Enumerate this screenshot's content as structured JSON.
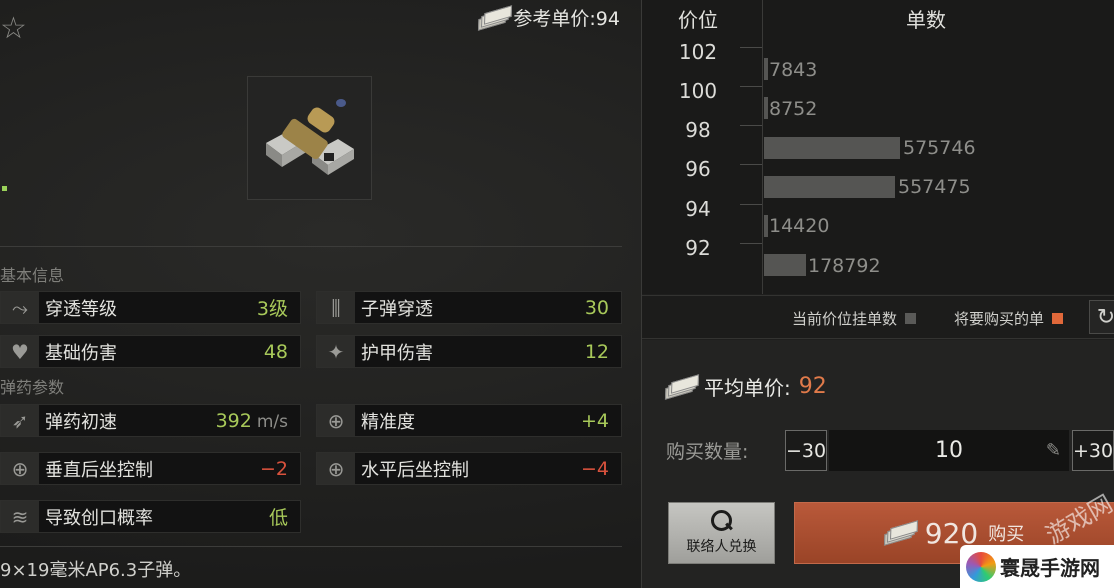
{
  "header": {
    "ref_price_label": "参考单价:94"
  },
  "sections": {
    "basic": "基本信息",
    "ammo": "弹药参数"
  },
  "stats": {
    "pen_level": {
      "name": "穿透等级",
      "value": "3级"
    },
    "bullet_pen": {
      "name": "子弹穿透",
      "value": "30"
    },
    "base_dmg": {
      "name": "基础伤害",
      "value": "48"
    },
    "armor_dmg": {
      "name": "护甲伤害",
      "value": "12"
    },
    "velocity": {
      "name": "弹药初速",
      "value": "392",
      "unit": "m/s"
    },
    "accuracy": {
      "name": "精准度",
      "value": "+4"
    },
    "v_recoil": {
      "name": "垂直后坐控制",
      "value": "−2"
    },
    "h_recoil": {
      "name": "水平后坐控制",
      "value": "−4"
    },
    "bleed": {
      "name": "导致创口概率",
      "value": "低"
    }
  },
  "description": "9×19毫米AP6.3子弹。",
  "market": {
    "col_price": "价位",
    "col_count": "单数",
    "rows": [
      {
        "price": "102",
        "count": ""
      },
      {
        "price": "100",
        "count": "7843"
      },
      {
        "price": "98",
        "count": "8752"
      },
      {
        "price": "96",
        "count": "575746"
      },
      {
        "price": "94",
        "count": "557475"
      },
      {
        "price": "92",
        "count": "14420"
      },
      {
        "price": "",
        "count": "178792"
      }
    ],
    "legend_current": "当前价位挂单数",
    "legend_buy": "将要购买的单",
    "current_color": "#5a5a58",
    "buy_color": "#e0683a"
  },
  "buy": {
    "avg_label": "平均单价:",
    "avg_value": "92",
    "qty_label": "购买数量:",
    "minus": "−30",
    "qty": "10",
    "plus": "+30",
    "barter_label": "联络人兑换",
    "total": "920",
    "buy_label": "购买"
  },
  "watermark": {
    "corner": "游戏网",
    "brand": "寰晟手游网"
  }
}
